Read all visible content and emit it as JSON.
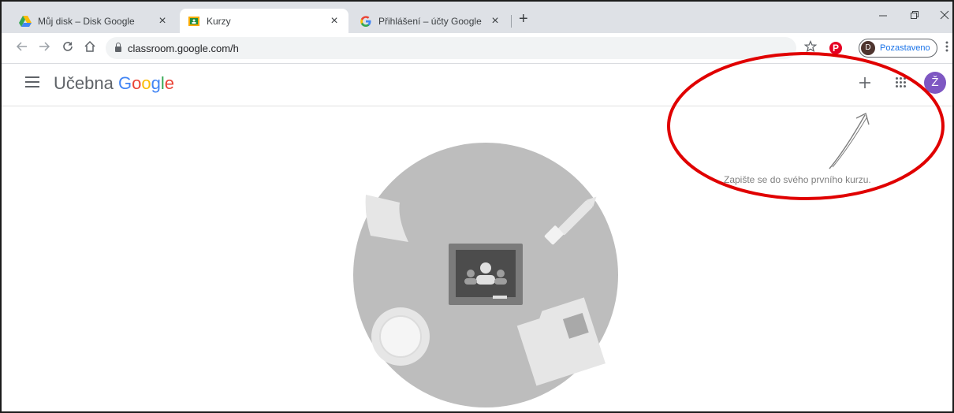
{
  "browser": {
    "tabs": [
      {
        "title": "Můj disk – Disk Google",
        "icon": "google-drive-icon",
        "active": false
      },
      {
        "title": "Kurzy",
        "icon": "classroom-icon",
        "active": true
      },
      {
        "title": "Přihlášení – účty Google",
        "icon": "google-g-icon",
        "active": false
      }
    ],
    "close_glyph": "×",
    "new_tab_glyph": "+",
    "url": "classroom.google.com/h",
    "profile": {
      "initial": "D",
      "label": "Pozastaveno"
    }
  },
  "app": {
    "title_prefix": "Učebna",
    "title_brand": "Google",
    "avatar_initial": "Ž",
    "empty_hint": "Zapište se do svého prvního kurzu."
  },
  "colors": {
    "google_blue": "#4285F4",
    "google_red": "#EA4335",
    "google_yellow": "#FBBC05",
    "google_green": "#34A853",
    "avatar": "#7e57c2",
    "annotation_ellipse": "#e00000"
  }
}
